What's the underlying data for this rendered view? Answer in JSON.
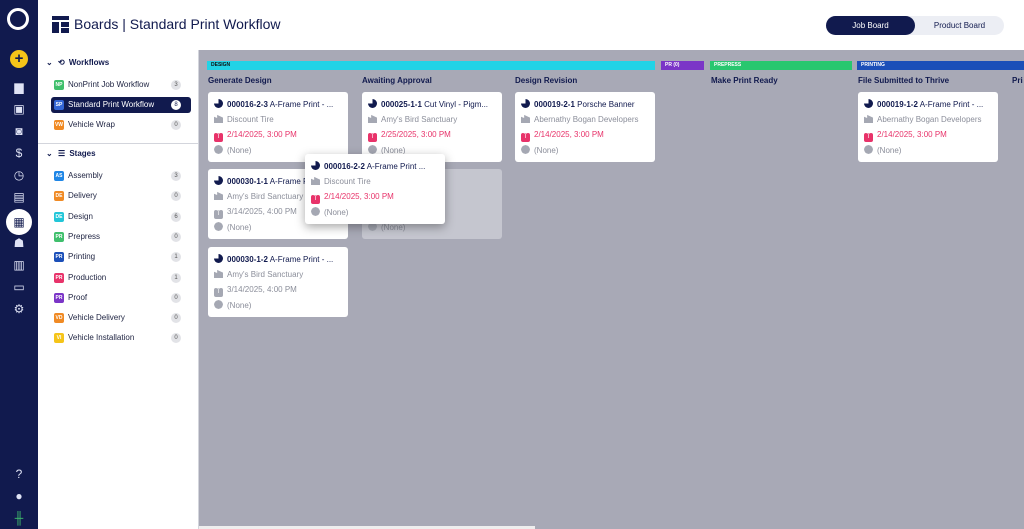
{
  "app": {
    "title": "Boards | Standard Print Workflow",
    "view_toggle": {
      "active": "Job Board",
      "inactive": "Product Board"
    }
  },
  "rail": {
    "icons": [
      "logo-icon",
      "add-icon",
      "chart-icon",
      "calendar-icon",
      "table-icon",
      "dollar-icon",
      "clock-icon",
      "document-icon",
      "boards-icon",
      "people-icon",
      "clipboard-icon",
      "inbox-icon",
      "gear-icon",
      "help-icon",
      "user-icon",
      "status-icon"
    ]
  },
  "sidebar": {
    "workflows_header": "Workflows",
    "stages_header": "Stages",
    "workflows": [
      {
        "abbr": "NP",
        "label": "NonPrint Job Workflow",
        "count": "3",
        "color": "#3fbf6c"
      },
      {
        "abbr": "SP",
        "label": "Standard Print Workflow",
        "count": "8",
        "color": "#3466d6",
        "active": true
      },
      {
        "abbr": "VW",
        "label": "Vehicle Wrap",
        "count": "0",
        "color": "#f08a24"
      }
    ],
    "stages": [
      {
        "abbr": "AS",
        "label": "Assembly",
        "count": "3",
        "color": "#1f86e6"
      },
      {
        "abbr": "DE",
        "label": "Delivery",
        "count": "0",
        "color": "#f08a24"
      },
      {
        "abbr": "DE",
        "label": "Design",
        "count": "6",
        "color": "#22c6d8"
      },
      {
        "abbr": "PR",
        "label": "Prepress",
        "count": "0",
        "color": "#3fbf6c"
      },
      {
        "abbr": "PR",
        "label": "Printing",
        "count": "1",
        "color": "#1b4fb8"
      },
      {
        "abbr": "PR",
        "label": "Production",
        "count": "1",
        "color": "#e8336a"
      },
      {
        "abbr": "PR",
        "label": "Proof",
        "count": "0",
        "color": "#7b35c7"
      },
      {
        "abbr": "VD",
        "label": "Vehicle Delivery",
        "count": "0",
        "color": "#f08a24"
      },
      {
        "abbr": "VI",
        "label": "Vehicle Installation",
        "count": "0",
        "color": "#f5c419"
      }
    ]
  },
  "board": {
    "stages": [
      {
        "label": "DESIGN",
        "color": "#22d3e6"
      },
      {
        "label": "PR (0)",
        "color": "#7b35c7"
      },
      {
        "label": "PREPRESS",
        "color": "#28c76f"
      },
      {
        "label": "PRINTING",
        "color": "#1b4fb8"
      }
    ],
    "columns": [
      {
        "title": "Generate Design"
      },
      {
        "title": "Awaiting Approval"
      },
      {
        "title": "Design Revision"
      },
      {
        "title": "Make Print Ready"
      },
      {
        "title": "File Submitted to Thrive"
      },
      {
        "title": "Pri"
      }
    ],
    "cards": [
      {
        "id": "000016-2-3",
        "name": "A-Frame Print - ...",
        "customer": "Discount Tire",
        "date": "2/14/2025, 3:00 PM",
        "overdue": true,
        "assignee": "(None)"
      },
      {
        "id": "000030-1-1",
        "name": "A-Frame Print - ...",
        "customer": "Amy's Bird Sanctuary",
        "date": "3/14/2025, 4:00 PM",
        "overdue": false,
        "assignee": "(None)"
      },
      {
        "id": "000030-1-2",
        "name": "A-Frame Print - ...",
        "customer": "Amy's Bird Sanctuary",
        "date": "3/14/2025, 4:00 PM",
        "overdue": false,
        "assignee": "(None)"
      },
      {
        "id": "000025-1-1",
        "name": "Cut Vinyl - Pigm...",
        "customer": "Amy's Bird Sanctuary",
        "date": "2/25/2025, 3:00 PM",
        "overdue": true,
        "assignee": "(None)"
      },
      {
        "id": "",
        "name": "e Print - ...",
        "customer": "Discount Tire",
        "date": "",
        "overdue": false,
        "assignee": "(None)"
      },
      {
        "id": "000019-2-1",
        "name": "Porsche Banner",
        "customer": "Abernathy Bogan Developers",
        "date": "2/14/2025, 3:00 PM",
        "overdue": true,
        "assignee": "(None)"
      },
      {
        "id": "000019-1-2",
        "name": "A-Frame Print - ...",
        "customer": "Abernathy Bogan Developers",
        "date": "2/14/2025, 3:00 PM",
        "overdue": true,
        "assignee": "(None)"
      },
      {
        "id": "000016-2-2",
        "name": "A-Frame Print ...",
        "customer": "Discount Tire",
        "date": "2/14/2025, 3:00 PM",
        "overdue": true,
        "assignee": "(None)"
      }
    ]
  }
}
